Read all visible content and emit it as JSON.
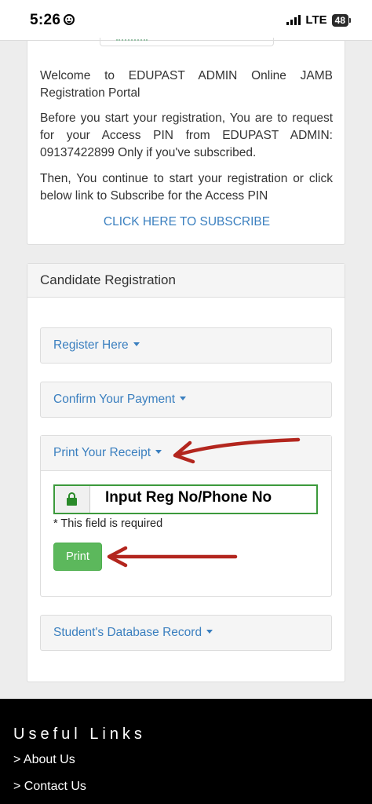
{
  "status_bar": {
    "time": "5:26",
    "network": "LTE",
    "battery": "48"
  },
  "intro": {
    "welcome_text": "Welcome to EDUPAST ADMIN Online JAMB Registration Portal",
    "pin_text": "Before you start your registration, You are to request for your Access PIN from EDUPAST ADMIN: 09137422899 Only if you've subscribed.",
    "continue_text": "Then, You continue to start your registration or click below link to Subscribe for the Access PIN",
    "subscribe_link": "CLICK HERE TO SUBSCRIBE"
  },
  "registration": {
    "heading": "Candidate Registration",
    "sections": {
      "register": "Register Here",
      "confirm_payment": "Confirm Your Payment",
      "print_receipt": "Print Your Receipt",
      "database_record": "Student's Database Record"
    },
    "receipt_form": {
      "input_annotation": "Input Reg No/Phone No",
      "required_note": "* This field is required",
      "print_button": "Print"
    }
  },
  "footer": {
    "title": "Useful Links",
    "links": [
      "> About Us",
      "> Contact Us"
    ]
  },
  "colors": {
    "link": "#3a7fbf",
    "success": "#5cb85c",
    "annotation_arrow": "#b3261e"
  },
  "icons": {
    "lock": "lock-icon",
    "caret": "caret-down-icon",
    "face": "smiley-icon"
  }
}
